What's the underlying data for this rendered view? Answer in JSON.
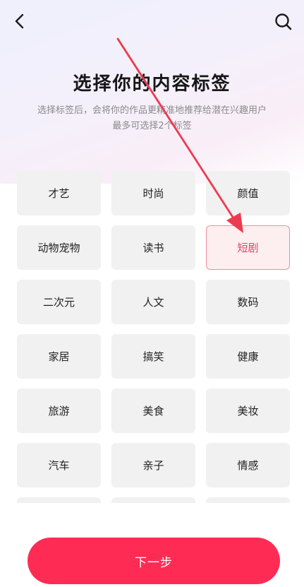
{
  "header": {
    "back_icon": "chevron-left-icon",
    "search_icon": "search-icon"
  },
  "title": "选择你的内容标签",
  "subtitle_line1": "选择标签后，会将你的作品更精准地推荐给潜在兴趣用户",
  "subtitle_line2": "最多可选择2个标签",
  "tags": [
    {
      "label": "才艺",
      "selected": false
    },
    {
      "label": "时尚",
      "selected": false
    },
    {
      "label": "颜值",
      "selected": false
    },
    {
      "label": "动物宠物",
      "selected": false
    },
    {
      "label": "读书",
      "selected": false
    },
    {
      "label": "短剧",
      "selected": true
    },
    {
      "label": "二次元",
      "selected": false
    },
    {
      "label": "人文",
      "selected": false
    },
    {
      "label": "数码",
      "selected": false
    },
    {
      "label": "家居",
      "selected": false
    },
    {
      "label": "搞笑",
      "selected": false
    },
    {
      "label": "健康",
      "selected": false
    },
    {
      "label": "旅游",
      "selected": false
    },
    {
      "label": "美食",
      "selected": false
    },
    {
      "label": "美妆",
      "selected": false
    },
    {
      "label": "汽车",
      "selected": false
    },
    {
      "label": "亲子",
      "selected": false
    },
    {
      "label": "情感",
      "selected": false
    }
  ],
  "next_button": "下一步",
  "colors": {
    "accent": "#fe2c55",
    "selected_text": "#ee3f63",
    "annotation_arrow": "#ee3a4e"
  }
}
